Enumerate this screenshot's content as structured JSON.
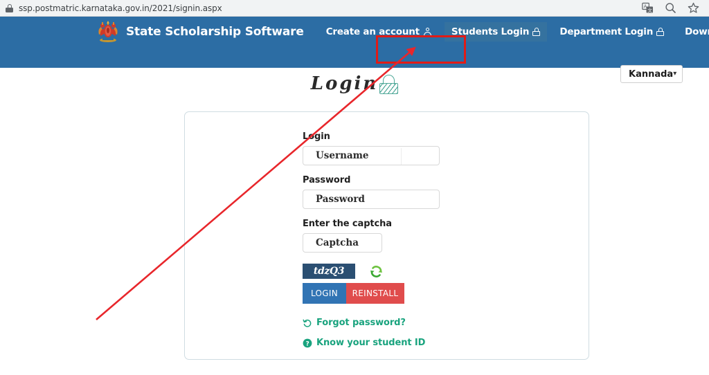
{
  "browser": {
    "url": "ssp.postmatric.karnataka.gov.in/2021/signin.aspx",
    "security_icon": "lock-icon",
    "actions": [
      {
        "name": "translate-icon",
        "label": "Translate"
      },
      {
        "name": "search-icon",
        "label": "Search"
      },
      {
        "name": "bookmark-star-icon",
        "label": "Bookmark"
      }
    ]
  },
  "header": {
    "background_color": "#2c6da4",
    "emblem_name": "karnataka-state-emblem",
    "brand_title": "State Scholarship Software",
    "nav_items": [
      {
        "label": "Create an account",
        "icon": "person-icon",
        "active": false
      },
      {
        "label": "Students Login",
        "icon": "lock-icon",
        "active": true
      },
      {
        "label": "Department Login",
        "icon": "lock-icon",
        "active": false
      },
      {
        "label": "Download",
        "icon": "cloud-download-icon",
        "active": false
      }
    ],
    "highlight": {
      "target": "Students Login",
      "color": "#e21b16"
    },
    "language": {
      "selected": "Kannada",
      "caret": "⌄"
    }
  },
  "page": {
    "title": "Login",
    "title_icon": "padlock-icon",
    "title_icon_color": "#4fa898"
  },
  "form": {
    "login_label": "Login",
    "username_placeholder": "Username",
    "password_label": "Password",
    "password_placeholder": "Password",
    "captcha_label": "Enter the captcha",
    "captcha_placeholder": "Captcha",
    "captcha_value": "tdzQ3",
    "captcha_bg_color": "#2b4f72",
    "refresh_icon": "refresh-icon",
    "login_button": "LOGIN",
    "login_button_color": "#3174b4",
    "reinstall_button": "REINSTALL",
    "reinstall_button_color": "#e04c4c",
    "forgot_password_link": "Forgot password?",
    "forgot_password_icon": "refresh-icon",
    "student_id_link": "Know your student ID",
    "student_id_icon": "question-circle-icon",
    "link_color": "#19a37e"
  }
}
